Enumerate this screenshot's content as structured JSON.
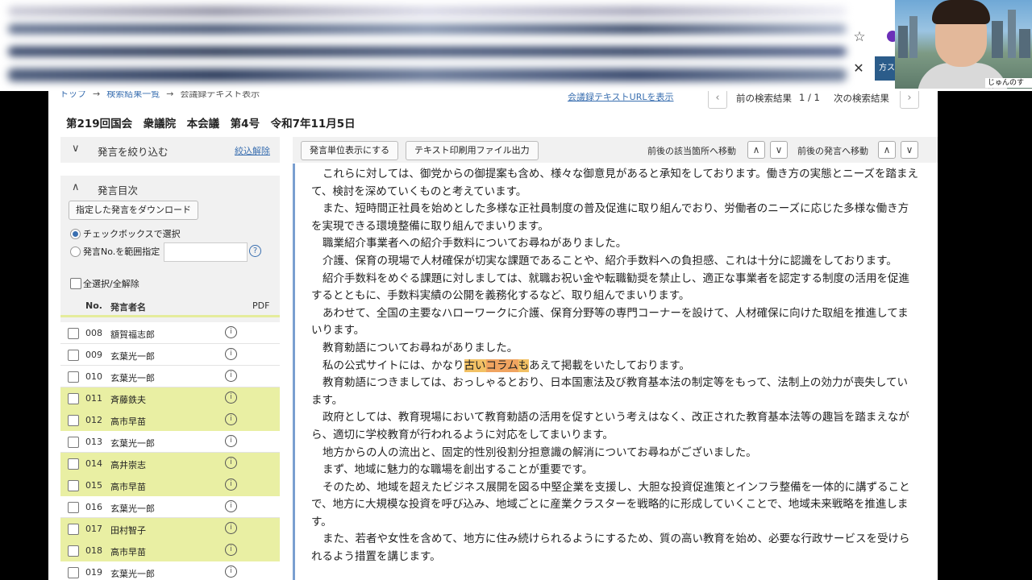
{
  "breadcrumb": {
    "home": "トップ",
    "results": "検索結果一覧",
    "current": "会議録テキスト表示"
  },
  "url_link": "会議録テキストURLを表示",
  "result_nav": {
    "prev": "前の検索結果",
    "position": "1 / 1",
    "next": "次の検索結果"
  },
  "heading": "第219回国会　衆議院　本会議　第4号　令和7年11月5日",
  "filter": {
    "title": "発言を絞り込む",
    "clear": "絞込解除"
  },
  "toc": {
    "title": "発言目次",
    "download_button": "指定した発言をダウンロード",
    "radio_checkbox": "チェックボックスで選択",
    "radio_range": "発言No.を範囲指定",
    "help": "?",
    "select_all": "全選択/全解除",
    "col_no": "No.",
    "col_speaker": "発言者名",
    "col_pdf": "PDF"
  },
  "speakers": [
    {
      "no": "008",
      "name": "額賀福志郎",
      "highlight": false
    },
    {
      "no": "009",
      "name": "玄葉光一郎",
      "highlight": false
    },
    {
      "no": "010",
      "name": "玄葉光一郎",
      "highlight": false
    },
    {
      "no": "011",
      "name": "斉藤鉄夫",
      "highlight": true
    },
    {
      "no": "012",
      "name": "高市早苗",
      "highlight": true
    },
    {
      "no": "013",
      "name": "玄葉光一郎",
      "highlight": false
    },
    {
      "no": "014",
      "name": "高井崇志",
      "highlight": true
    },
    {
      "no": "015",
      "name": "高市早苗",
      "highlight": true
    },
    {
      "no": "016",
      "name": "玄葉光一郎",
      "highlight": false
    },
    {
      "no": "017",
      "name": "田村智子",
      "highlight": true
    },
    {
      "no": "018",
      "name": "高市早苗",
      "highlight": true
    },
    {
      "no": "019",
      "name": "玄葉光一郎",
      "highlight": false
    }
  ],
  "toolbar": {
    "by_speech": "発言単位表示にする",
    "print_output": "テキスト印刷用ファイル出力",
    "move_match": "前後の該当箇所へ移動",
    "move_speech": "前後の発言へ移動"
  },
  "paragraphs": [
    "これらに対しては、御党からの御提案も含め、様々な御意見があると承知をしております。働き方の実態とニーズを踏まえて、検討を深めていくものと考えています。",
    "また、短時間正社員を始めとした多様な正社員制度の普及促進に取り組んでおり、労働者のニーズに応じた多様な働き方を実現できる環境整備に取り組んでまいります。",
    "職業紹介事業者への紹介手数料についてお尋ねがありました。",
    "介護、保育の現場で人材確保が切実な課題であることや、紹介手数料への負担感、これは十分に認識をしております。",
    "紹介手数料をめぐる課題に対しましては、就職お祝い金や転職勧奨を禁止し、適正な事業者を認定する制度の活用を促進するとともに、手数料実績の公開を義務化するなど、取り組んでまいります。",
    "あわせて、全国の主要なハローワークに介護、保育分野等の専門コーナーを設けて、人材確保に向けた取組を推進してまいります。",
    "教育勅語についてお尋ねがありました。",
    {
      "before": "私の公式サイトには、かなり",
      "hl1": "古い",
      "hl2": "コラム",
      "hl3": "も",
      "after": "あえて掲載をいたしております。"
    },
    "教育勅語につきましては、おっしゃるとおり、日本国憲法及び教育基本法の制定等をもって、法制上の効力が喪失しています。",
    "政府としては、教育現場において教育勅語の活用を促すという考えはなく、改正された教育基本法等の趣旨を踏まえながら、適切に学校教育が行われるように対応をしてまいります。",
    "地方からの人の流出と、固定的性別役割分担意識の解消についてお尋ねがございました。",
    "まず、地域に魅力的な職場を創出することが重要です。",
    "そのため、地域を超えたビジネス展開を図る中堅企業を支援し、大胆な投資促進策とインフラ整備を一体的に講ずることで、地方に大規模な投資を呼び込み、地域ごとに産業クラスターを戦略的に形成していくことで、地域未来戦略を推進します。",
    "また、若者や女性を含めて、地方に住み続けられるようにするため、質の高い教育を始め、必要な行政サービスを受けられるよう措置を講じます。"
  ],
  "browser": {
    "tab_label": "方ス"
  },
  "webcam": {
    "name": "じゅんのすけ"
  }
}
